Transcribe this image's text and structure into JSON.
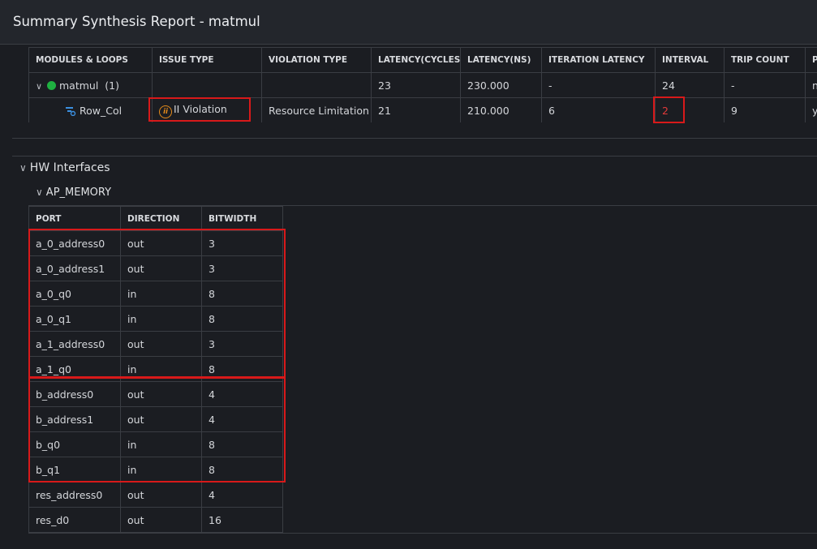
{
  "title": "Summary Synthesis Report - matmul",
  "summary": {
    "columns": [
      "MODULES & LOOPS",
      "ISSUE TYPE",
      "VIOLATION TYPE",
      "LATENCY(CYCLES)",
      "LATENCY(NS)",
      "ITERATION LATENCY",
      "INTERVAL",
      "TRIP COUNT",
      "P"
    ],
    "rows": [
      {
        "module": "matmul",
        "count": "(1)",
        "issue": "",
        "violation": "",
        "latency_cycles": "23",
        "latency_ns": "230.000",
        "iteration_latency": "-",
        "interval": "24",
        "trip_count": "-",
        "p": "no"
      },
      {
        "module": "Row_Col",
        "issue_icon": "ii",
        "issue": "II Violation",
        "violation": "Resource Limitation",
        "latency_cycles": "21",
        "latency_ns": "210.000",
        "iteration_latency": "6",
        "interval": "2",
        "trip_count": "9",
        "p": "yes"
      }
    ]
  },
  "hw_interfaces": {
    "label": "HW Interfaces",
    "ap_memory": {
      "label": "AP_MEMORY",
      "columns": [
        "PORT",
        "DIRECTION",
        "BITWIDTH"
      ],
      "rows": [
        {
          "port": "a_0_address0",
          "direction": "out",
          "bitwidth": "3"
        },
        {
          "port": "a_0_address1",
          "direction": "out",
          "bitwidth": "3"
        },
        {
          "port": "a_0_q0",
          "direction": "in",
          "bitwidth": "8"
        },
        {
          "port": "a_0_q1",
          "direction": "in",
          "bitwidth": "8"
        },
        {
          "port": "a_1_address0",
          "direction": "out",
          "bitwidth": "3"
        },
        {
          "port": "a_1_q0",
          "direction": "in",
          "bitwidth": "8"
        },
        {
          "port": "b_address0",
          "direction": "out",
          "bitwidth": "4"
        },
        {
          "port": "b_address1",
          "direction": "out",
          "bitwidth": "4"
        },
        {
          "port": "b_q0",
          "direction": "in",
          "bitwidth": "8"
        },
        {
          "port": "b_q1",
          "direction": "in",
          "bitwidth": "8"
        },
        {
          "port": "res_address0",
          "direction": "out",
          "bitwidth": "4"
        },
        {
          "port": "res_d0",
          "direction": "out",
          "bitwidth": "16"
        }
      ]
    }
  },
  "colors": {
    "status_ok": "#1fb141",
    "violation": "#e23a3a",
    "highlight": "#d8191a",
    "warning_icon": "#e48a1a"
  },
  "icons": [
    "chevron-down-icon",
    "status-dot-icon",
    "loop-icon",
    "ii-violation-icon"
  ]
}
